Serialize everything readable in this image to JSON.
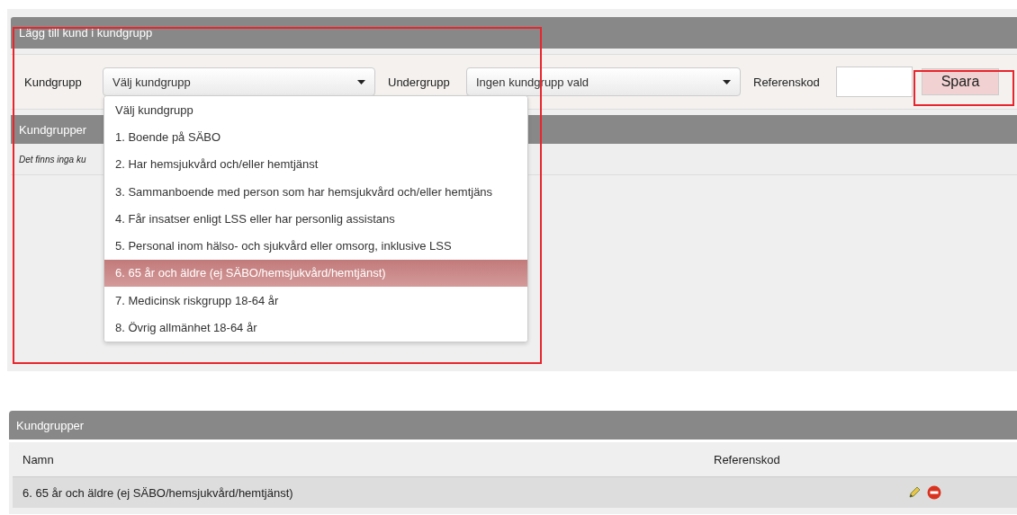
{
  "add_panel": {
    "title": "Lägg till kund i kundgrupp",
    "form": {
      "group_label": "Kundgrupp",
      "group_value": "Välj kundgrupp",
      "subgroup_label": "Undergrupp",
      "subgroup_value": "Ingen kundgrupp vald",
      "refcode_label": "Referenskod",
      "save_button": "Spara"
    },
    "dropdown": [
      {
        "label": "Välj kundgrupp",
        "selected": false
      },
      {
        "label": "1. Boende på SÄBO",
        "selected": false
      },
      {
        "label": "2. Har hemsjukvård och/eller hemtjänst",
        "selected": false
      },
      {
        "label": "3. Sammanboende med person som har hemsjukvård och/eller hemtjäns",
        "selected": false
      },
      {
        "label": "4. Får insatser enligt LSS eller har personlig assistans",
        "selected": false
      },
      {
        "label": "5. Personal inom hälso- och sjukvård eller omsorg, inklusive LSS",
        "selected": false
      },
      {
        "label": "6. 65 år och äldre (ej SÄBO/hemsjukvård/hemtjänst)",
        "selected": true
      },
      {
        "label": "7. Medicinsk riskgrupp 18-64 år",
        "selected": false
      },
      {
        "label": "8. Övrig allmänhet 18-64 år",
        "selected": false
      }
    ],
    "groups_title": "Kundgrupper",
    "empty_message": "Det finns inga ku"
  },
  "groups_panel": {
    "title": "Kundgrupper",
    "columns": [
      "Namn",
      "Referenskod"
    ],
    "rows": [
      {
        "name": "6. 65 år och äldre (ej SÄBO/hemsjukvård/hemtjänst)",
        "refcode": ""
      }
    ]
  }
}
